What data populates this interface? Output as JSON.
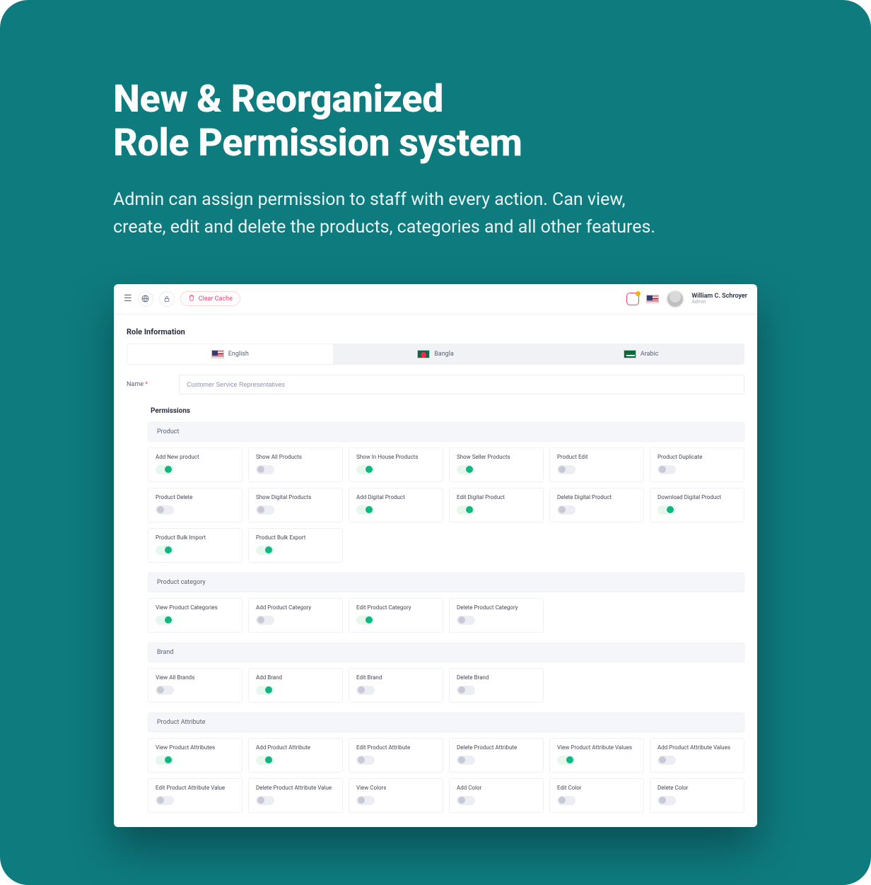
{
  "hero": {
    "title_line1": "New & Reorganized",
    "title_line2": "Role Permission system",
    "subtitle": "Admin can assign permission to staff with every action. Can view, create, edit and delete the products, categories and all other features."
  },
  "topbar": {
    "clear_cache": "Clear Cache",
    "user_name": "William C. Schroyer",
    "user_role": "Admin"
  },
  "section": {
    "role_info": "Role Information",
    "permissions": "Permissions",
    "name_label": "Name"
  },
  "lang_tabs": [
    "English",
    "Bangla",
    "Arabic"
  ],
  "role_name_value": "Customer Service Representatives",
  "permission_groups": [
    {
      "title": "Product",
      "items": [
        {
          "label": "Add New product",
          "on": true
        },
        {
          "label": "Show All Products",
          "on": false
        },
        {
          "label": "Show In House Products",
          "on": true
        },
        {
          "label": "Show Seller Products",
          "on": true
        },
        {
          "label": "Product Edit",
          "on": false
        },
        {
          "label": "Product Duplicate",
          "on": false
        },
        {
          "label": "Product Delete",
          "on": false
        },
        {
          "label": "Show Digital Products",
          "on": false
        },
        {
          "label": "Add Digital Product",
          "on": true
        },
        {
          "label": "Edit Digital Product",
          "on": true
        },
        {
          "label": "Delete Digital Product",
          "on": false
        },
        {
          "label": "Download Digital Product",
          "on": true
        },
        {
          "label": "Product Bulk Import",
          "on": true
        },
        {
          "label": "Product Bulk Export",
          "on": true
        }
      ]
    },
    {
      "title": "Product category",
      "items": [
        {
          "label": "View Product Categories",
          "on": true
        },
        {
          "label": "Add Product Category",
          "on": false
        },
        {
          "label": "Edit Product Category",
          "on": true
        },
        {
          "label": "Delete Product Category",
          "on": false
        }
      ]
    },
    {
      "title": "Brand",
      "items": [
        {
          "label": "View All Brands",
          "on": false
        },
        {
          "label": "Add Brand",
          "on": true
        },
        {
          "label": "Edit Brand",
          "on": false
        },
        {
          "label": "Delete Brand",
          "on": false
        }
      ]
    },
    {
      "title": "Product Attribute",
      "items": [
        {
          "label": "View Product Attributes",
          "on": true
        },
        {
          "label": "Add Product Attribute",
          "on": true
        },
        {
          "label": "Edit Product Attribute",
          "on": false
        },
        {
          "label": "Delete Product Attribute",
          "on": false
        },
        {
          "label": "View Product Attribute Values",
          "on": true
        },
        {
          "label": "Add Product Attribute Values",
          "on": false
        },
        {
          "label": "Edit Product Attribute Value",
          "on": false
        },
        {
          "label": "Delete Product Attribute Value",
          "on": false
        },
        {
          "label": "View Colors",
          "on": false
        },
        {
          "label": "Add Color",
          "on": false
        },
        {
          "label": "Edit Color",
          "on": false
        },
        {
          "label": "Delete Color",
          "on": false
        }
      ]
    }
  ]
}
